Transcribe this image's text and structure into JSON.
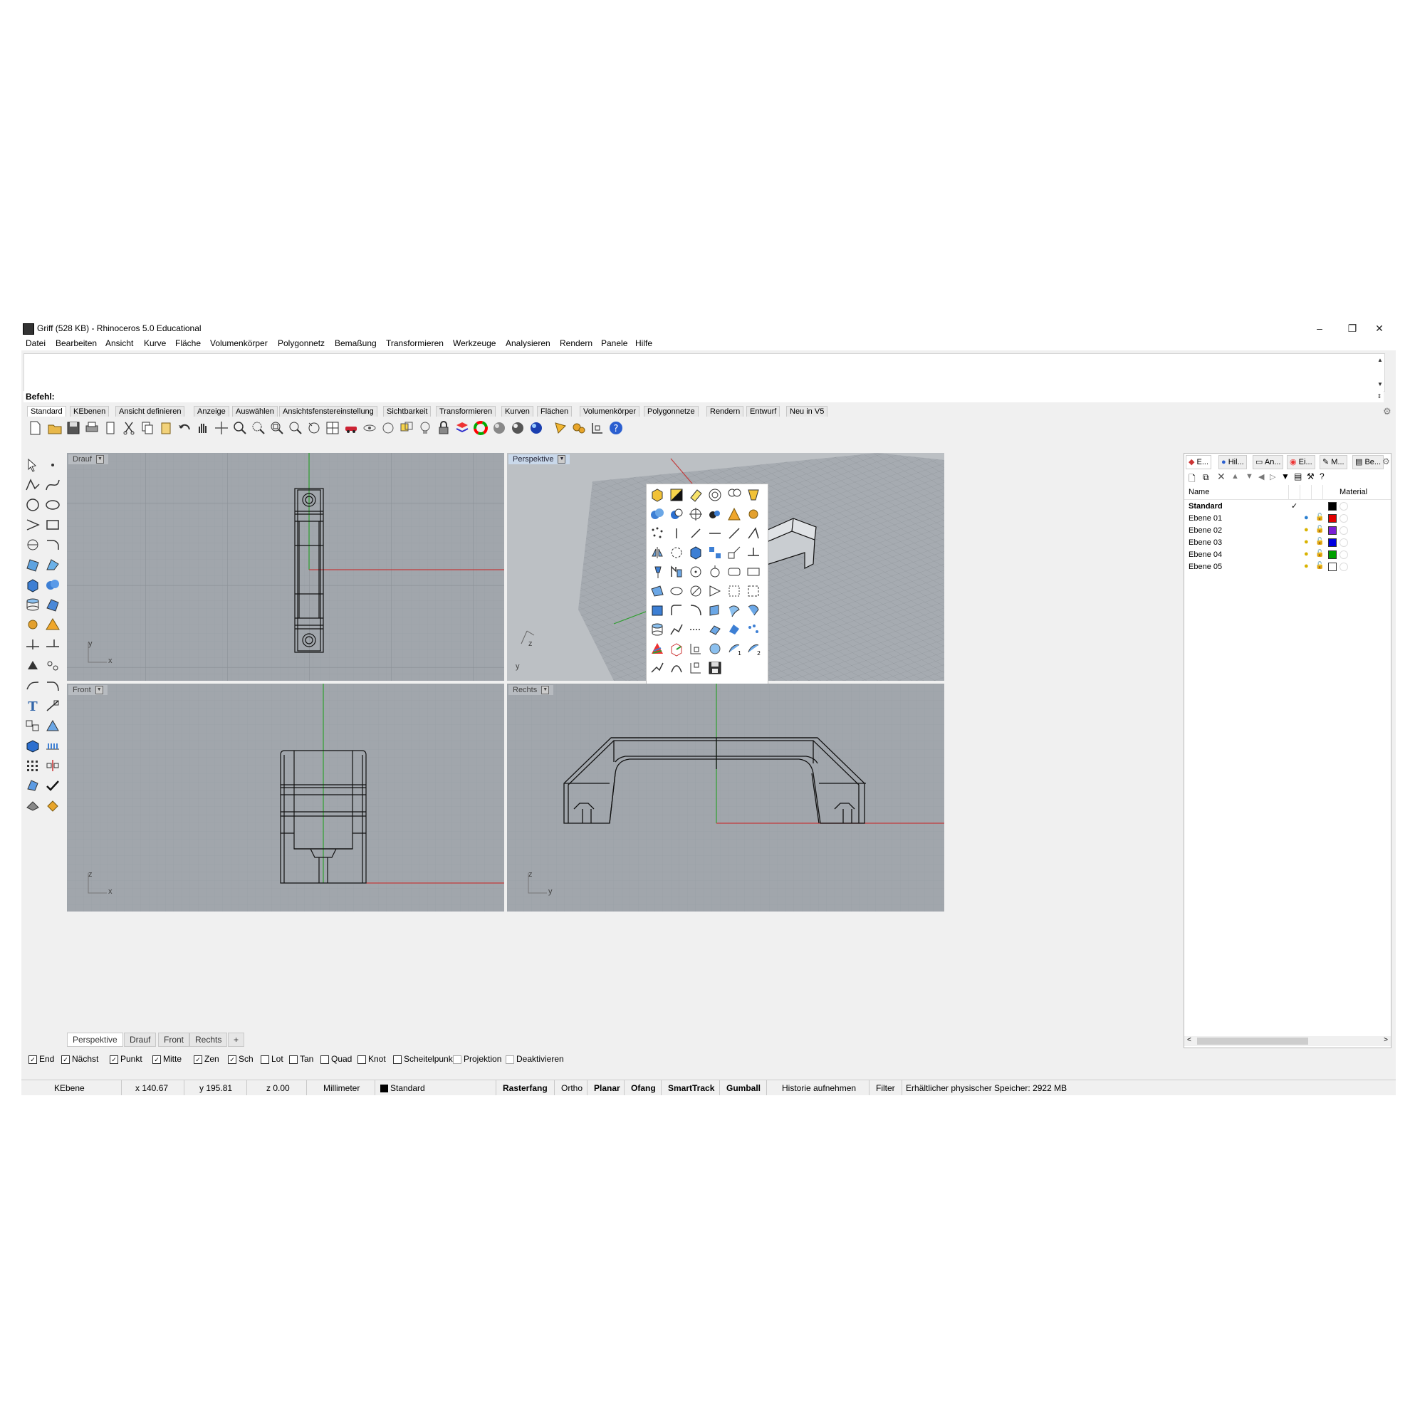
{
  "window": {
    "title": "Griff (528 KB) - Rhinoceros 5.0 Educational",
    "minimize": "–",
    "restore": "❐",
    "close": "✕"
  },
  "menu": [
    "Datei",
    "Bearbeiten",
    "Ansicht",
    "Kurve",
    "Fläche",
    "Volumenkörper",
    "Polygonnetz",
    "Bemaßung",
    "Transformieren",
    "Werkzeuge",
    "Analysieren",
    "Rendern",
    "Panele",
    "Hilfe"
  ],
  "command": {
    "label": "Befehl:"
  },
  "toolbar_tabs": [
    "Standard",
    "KEbenen",
    "Ansicht definieren",
    "Anzeige",
    "Auswählen",
    "Ansichtsfenstereinstellung",
    "Sichtbarkeit",
    "Transformieren",
    "Kurven",
    "Flächen",
    "Volumenkörper",
    "Polygonnetze",
    "Rendern",
    "Entwurf",
    "Neu in V5"
  ],
  "viewports": {
    "top": {
      "label": "Drauf"
    },
    "persp": {
      "label": "Perspektive"
    },
    "front": {
      "label": "Front"
    },
    "right": {
      "label": "Rechts"
    }
  },
  "axes": {
    "x": "x",
    "y": "y",
    "z": "z"
  },
  "viewport_tabs": [
    "Perspektive",
    "Drauf",
    "Front",
    "Rechts"
  ],
  "viewport_tab_add": "+",
  "osnaps": [
    {
      "label": "End",
      "checked": true
    },
    {
      "label": "Nächst",
      "checked": true
    },
    {
      "label": "Punkt",
      "checked": true
    },
    {
      "label": "Mitte",
      "checked": true
    },
    {
      "label": "Zen",
      "checked": true
    },
    {
      "label": "Sch",
      "checked": true
    },
    {
      "label": "Lot",
      "checked": false
    },
    {
      "label": "Tan",
      "checked": false
    },
    {
      "label": "Quad",
      "checked": false
    },
    {
      "label": "Knot",
      "checked": false
    },
    {
      "label": "Scheitelpunkt",
      "checked": false
    },
    {
      "label": "Projektion",
      "checked": false
    },
    {
      "label": "Deaktivieren",
      "checked": false
    }
  ],
  "status": {
    "layer_field": "KEbene",
    "x": "x 140.67",
    "y": "y 195.81",
    "z": "z 0.00",
    "units": "Millimeter",
    "current_layer": "Standard",
    "rasterfang": "Rasterfang",
    "ortho": "Ortho",
    "planar": "Planar",
    "ofang": "Ofang",
    "smarttrack": "SmartTrack",
    "gumball": "Gumball",
    "history": "Historie aufnehmen",
    "filter": "Filter",
    "memory": "Erhältlicher physischer Speicher: 2922 MB"
  },
  "panel": {
    "tabs": [
      "E...",
      "Hil...",
      "An...",
      "Ei...",
      "M...",
      "Be..."
    ],
    "col_name": "Name",
    "col_material": "Material",
    "layers": [
      {
        "name": "Standard",
        "current": true,
        "check": "✓",
        "color": "#000000",
        "bold": true
      },
      {
        "name": "Ebene 01",
        "current": false,
        "check": "",
        "color": "#e00000",
        "bold": false
      },
      {
        "name": "Ebene 02",
        "current": false,
        "check": "",
        "color": "#7a1fd6",
        "bold": false
      },
      {
        "name": "Ebene 03",
        "current": false,
        "check": "",
        "color": "#0000e0",
        "bold": false
      },
      {
        "name": "Ebene 04",
        "current": false,
        "check": "",
        "color": "#00a000",
        "bold": false
      },
      {
        "name": "Ebene 05",
        "current": false,
        "check": "",
        "color": "#ffffff",
        "bold": false
      }
    ]
  }
}
